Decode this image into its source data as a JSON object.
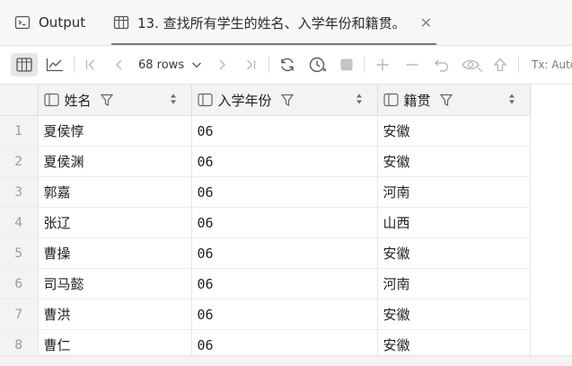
{
  "tabs": {
    "output_label": "Output",
    "query_label": "13. 查找所有学生的姓名、入学年份和籍贯。",
    "close_glyph": "✕"
  },
  "toolbar": {
    "rows_label": "68 rows",
    "tx_label": "Tx: Auto"
  },
  "table": {
    "columns": [
      "姓名",
      "入学年份",
      "籍贯"
    ],
    "rows": [
      {
        "n": "1",
        "name": "夏侯惇",
        "year": "06",
        "origin": "安徽"
      },
      {
        "n": "2",
        "name": "夏侯渊",
        "year": "06",
        "origin": "安徽"
      },
      {
        "n": "3",
        "name": "郭嘉",
        "year": "06",
        "origin": "河南"
      },
      {
        "n": "4",
        "name": "张辽",
        "year": "06",
        "origin": "山西"
      },
      {
        "n": "5",
        "name": "曹操",
        "year": "06",
        "origin": "安徽"
      },
      {
        "n": "6",
        "name": "司马懿",
        "year": "06",
        "origin": "河南"
      },
      {
        "n": "7",
        "name": "曹洪",
        "year": "06",
        "origin": "安徽"
      },
      {
        "n": "8",
        "name": "曹仁",
        "year": "06",
        "origin": "安徽"
      }
    ]
  }
}
